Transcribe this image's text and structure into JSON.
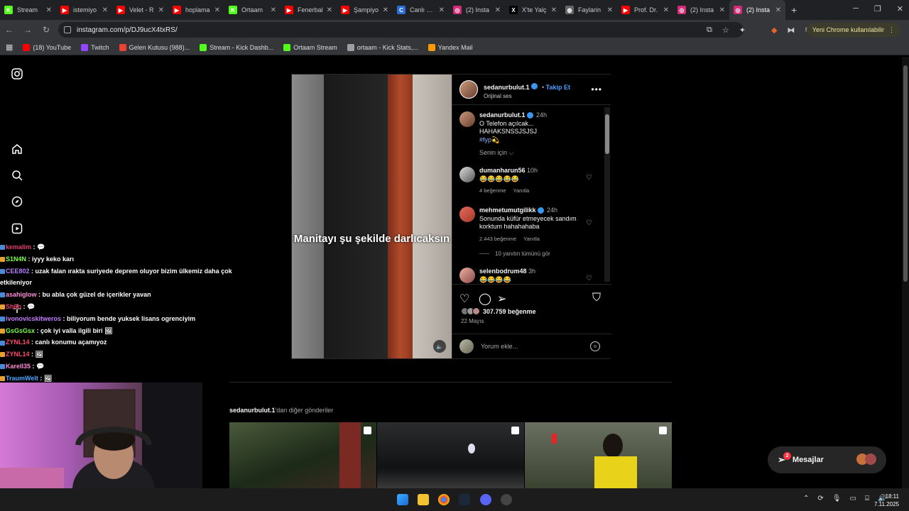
{
  "browser": {
    "tabs": [
      {
        "label": "Stream",
        "color": "#53fc18",
        "glyph": "K"
      },
      {
        "label": "istemiyo",
        "color": "#ff0000",
        "glyph": "▶"
      },
      {
        "label": "Velet - R",
        "color": "#ff0000",
        "glyph": "▶"
      },
      {
        "label": "hoplama",
        "color": "#ff0000",
        "glyph": "▶"
      },
      {
        "label": "Ortaam",
        "color": "#53fc18",
        "glyph": "K"
      },
      {
        "label": "Fenerbal",
        "color": "#ff0000",
        "glyph": "▶"
      },
      {
        "label": "Şampiyo",
        "color": "#ff0000",
        "glyph": "▶"
      },
      {
        "label": "Canlı Sov",
        "color": "#2a6fd6",
        "glyph": "C"
      },
      {
        "label": "(2) Insta",
        "color": "#d62976",
        "glyph": "◎"
      },
      {
        "label": "X'te Yalç",
        "color": "#000000",
        "glyph": "X"
      },
      {
        "label": "Faylarin",
        "color": "#666666",
        "glyph": "◍"
      },
      {
        "label": "Prof. Dr.",
        "color": "#ff0000",
        "glyph": "▶"
      },
      {
        "label": "(2) Insta",
        "color": "#d62976",
        "glyph": "◎"
      },
      {
        "label": "(2) Insta",
        "color": "#d62976",
        "glyph": "◎"
      }
    ],
    "active_tab": 13,
    "new_tab": "+",
    "url": "instagram.com/p/DJ9ucX4txRS/",
    "update_label": "Yeni Chrome kullanılabilir",
    "profile_initial": "C",
    "bookmarks": [
      {
        "label": "(18) YouTube",
        "color": "#ff0000"
      },
      {
        "label": "Twitch",
        "color": "#9146ff"
      },
      {
        "label": "Gelen Kutusu (988)...",
        "color": "#ea4335"
      },
      {
        "label": "Stream - Kick Dashb...",
        "color": "#53fc18"
      },
      {
        "label": "Ortaam Stream",
        "color": "#53fc18"
      },
      {
        "label": "ortaam - Kick Stats,...",
        "color": "#9aa0a6"
      },
      {
        "label": "Yandex Mail",
        "color": "#ff9900"
      }
    ]
  },
  "post": {
    "author": "sedanurbulut.1",
    "follow": "Takip Et",
    "audio": "Orijinal ses",
    "video_caption": "Manitayı şu şekilde darlıcaksın",
    "caption": {
      "time": "24h",
      "text": "O Telefon açılcak... HAHAKSNSSJSJSJ",
      "tag": "#fyp💫"
    },
    "for_you": "Senin için",
    "comments": [
      {
        "user": "dumanharun56",
        "time": "10h",
        "text": "😂😂😂😂😂",
        "likes": "4 beğenme",
        "reply": "Yanıtla"
      },
      {
        "user": "mehmetumutgilikk",
        "time": "24h",
        "text": "Sonunda küfür etmeyecek sandım korktum hahahahaba",
        "likes": "2.443 beğenme",
        "reply": "Yanıtla"
      },
      {
        "user": "selenbodrum48",
        "time": "3h",
        "text": "😂😂😂😂"
      }
    ],
    "see_replies": "10 yanıtın tümünü gör",
    "like_count": "307.759 beğenme",
    "date": "22 Mayıs",
    "comment_placeholder": "Yorum ekle..."
  },
  "more_posts": {
    "user": "sedanurbulut.1",
    "suffix": "'dan diğer gönderiler"
  },
  "messages": {
    "label": "Mesajlar",
    "badge": "2"
  },
  "chat": [
    {
      "user": "kemalim",
      "color": "#e33c6f",
      "msg": " : 💬"
    },
    {
      "user": "S1N4N",
      "color": "#7dff4a",
      "msg": " : iyyy keko karı"
    },
    {
      "user": "CEE802",
      "color": "#b57dff",
      "msg": " : uzak falan ırakta suriyede deprem oluyor bizim ülkemiz daha çok"
    },
    {
      "user": "",
      "color": "#ffffff",
      "msg": "etkileniyor"
    },
    {
      "user": "asahiglow",
      "color": "#ff8ad8",
      "msg": " : bu abla çok güzel de içerikler yavan"
    },
    {
      "user": "Sh6h",
      "color": "#e33c6f",
      "msg": " : 💬"
    },
    {
      "user": "ivonovicskitweros",
      "color": "#c57dff",
      "msg": " : biliyorum bende yuksek lisans ogrenciyim"
    },
    {
      "user": "GsGsGsx",
      "color": "#7dff4a",
      "msg": " : çok iyi valla ilgili biri 🖼"
    },
    {
      "user": "ZYNL14",
      "color": "#ff4a6a",
      "msg": " : canlı konumu açamıyoz"
    },
    {
      "user": "ZYNL14",
      "color": "#ff4a6a",
      "msg": " : 🖼"
    },
    {
      "user": "Karell35",
      "color": "#ff8ad8",
      "msg": " : 💬"
    },
    {
      "user": "TraumWelt",
      "color": "#4aa8ff",
      "msg": " : 🖼"
    }
  ],
  "taskbar": {
    "time": "18:11",
    "date": "7.11.2025"
  }
}
